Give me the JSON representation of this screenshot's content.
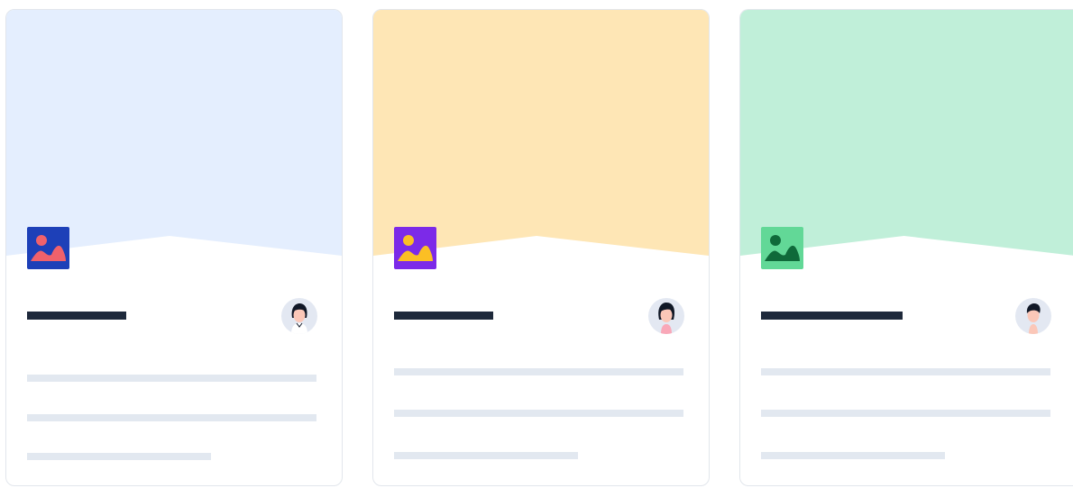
{
  "cards": [
    {
      "hero_color": "#e4eefe",
      "icon_bg": "#1d40b8",
      "icon_fg": "#f0616b",
      "icon": "image-icon",
      "avatar_icon": "woman-avatar-icon",
      "title": ""
    },
    {
      "hero_color": "#fee6b5",
      "icon_bg": "#7c2ae8",
      "icon_fg": "#fbbf24",
      "icon": "image-icon",
      "avatar_icon": "woman-avatar-icon",
      "title": ""
    },
    {
      "hero_color": "#c0efd9",
      "icon_bg": "#62d897",
      "icon_fg": "#0f6a3a",
      "icon": "image-icon",
      "avatar_icon": "man-avatar-icon",
      "title": ""
    }
  ]
}
